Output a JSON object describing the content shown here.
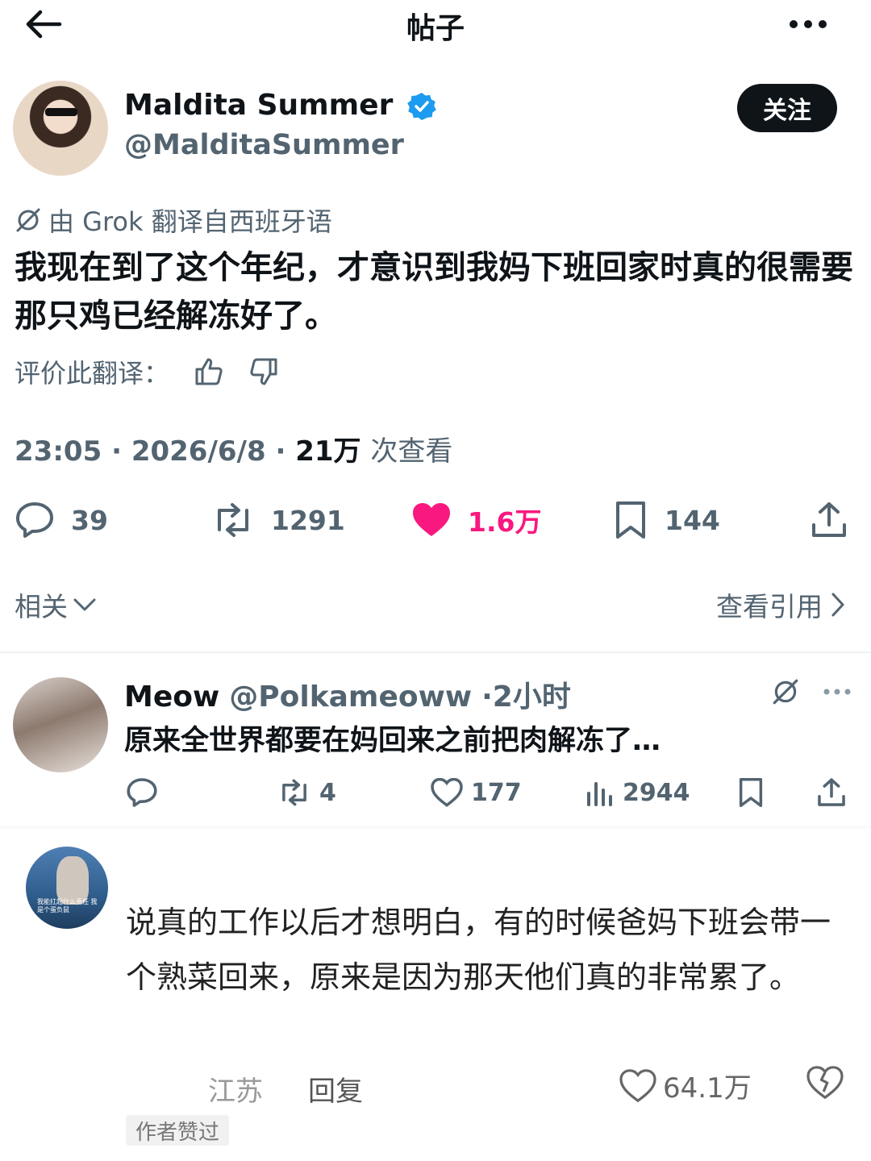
{
  "header": {
    "title": "帖子"
  },
  "post": {
    "author_name": "Maldita Summer",
    "author_handle": "@MalditaSummer",
    "follow_label": "关注",
    "translated_note": "由 Grok 翻译自西班牙语",
    "text": "我现在到了这个年纪，才意识到我妈下班回家时真的很需要那只鸡已经解冻好了。",
    "rate_label": "评价此翻译：",
    "time": "23:05",
    "date": "2026/6/8",
    "views": "21万",
    "views_suffix": "次查看",
    "replies": "39",
    "reposts": "1291",
    "likes": "1.6万",
    "bookmarks": "144",
    "related_label": "相关",
    "quotes_label": "查看引用",
    "colors": {
      "accent": "#1d9bf0",
      "like": "#f91880"
    }
  },
  "reply": {
    "name": "Meow",
    "handle": "@Polkameoww",
    "time": "·2小时",
    "text": "原来全世界都要在妈回来之前把肉解冻了…",
    "reposts": "4",
    "likes": "177",
    "views": "2944"
  },
  "comment": {
    "avatar_caption": "我能扛起什么责任 我是个蛋负鼠",
    "text": "说真的工作以后才想明白，有的时候爸妈下班会带一个熟菜回来，原来是因为那天他们真的非常累了。",
    "location": "江苏",
    "reply_label": "回复",
    "likes": "64.1万",
    "author_liked": "作者赞过"
  }
}
